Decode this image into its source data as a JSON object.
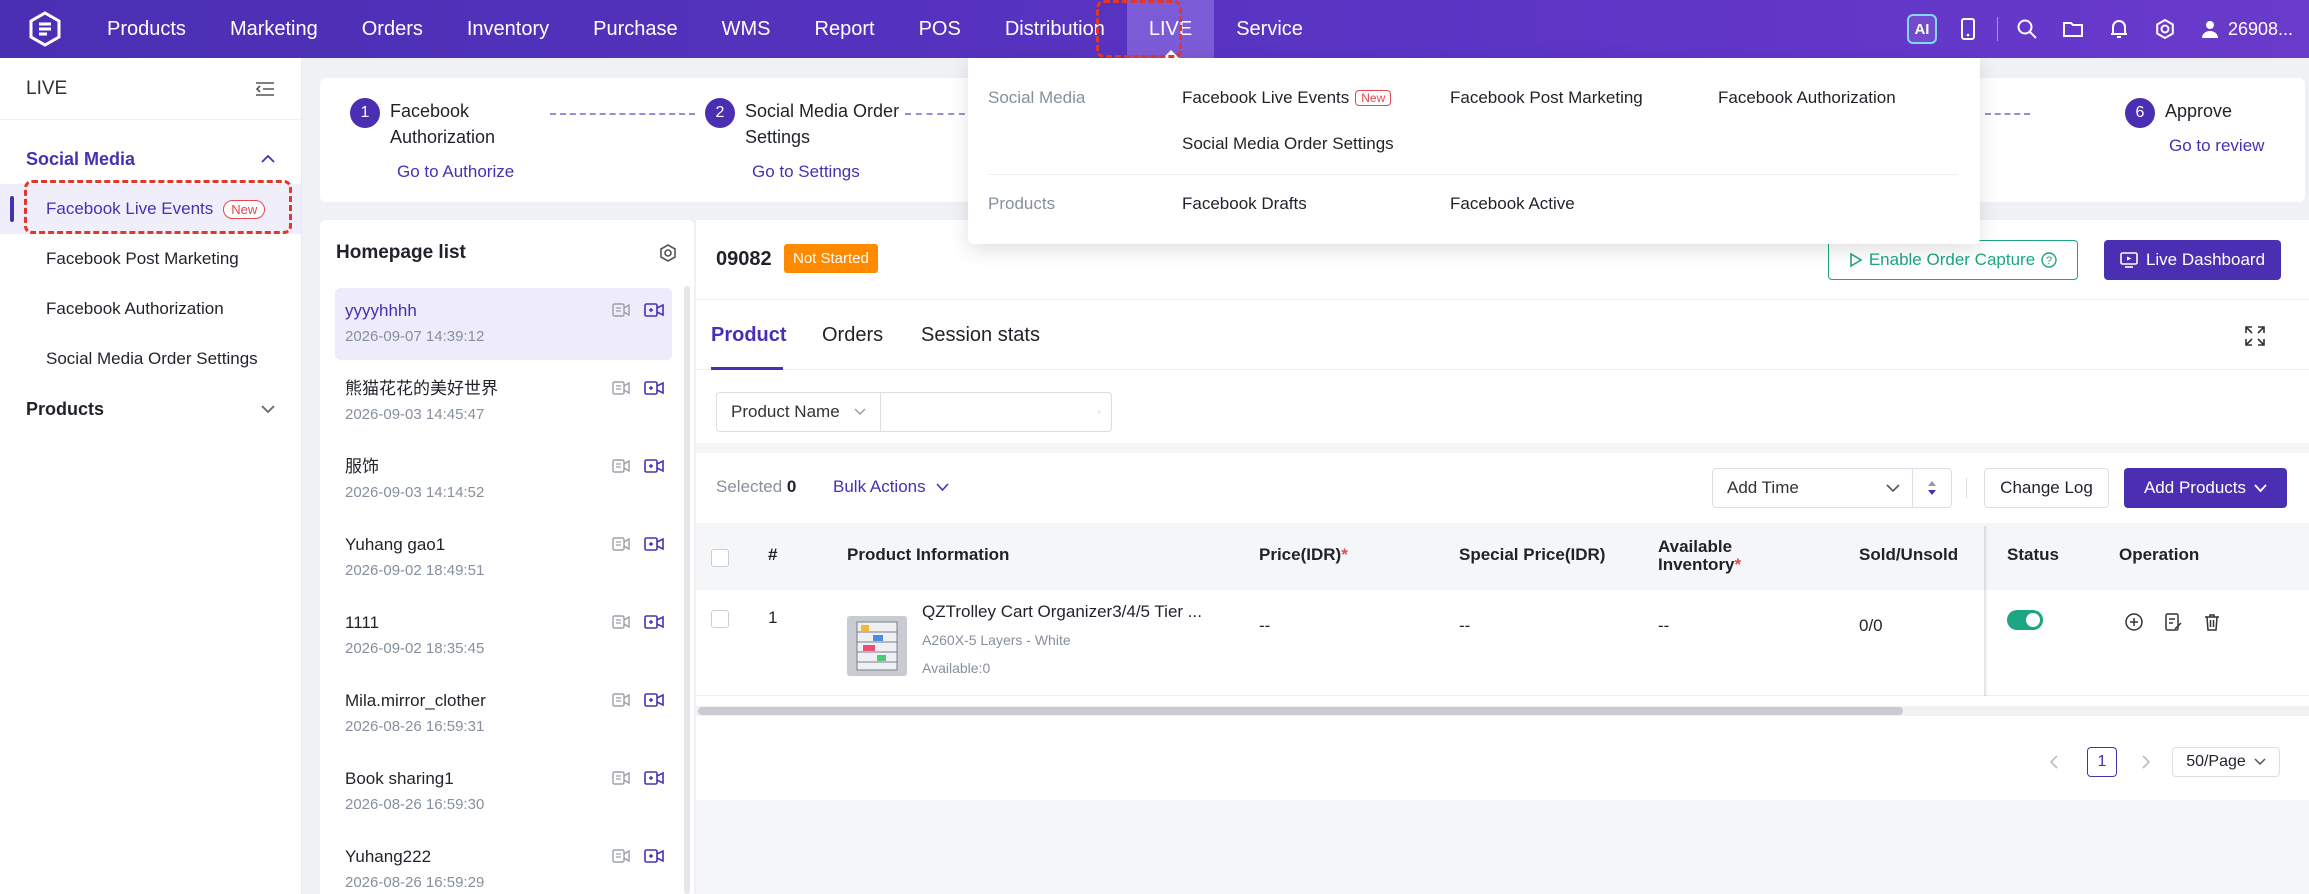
{
  "nav": {
    "items": [
      "Products",
      "Marketing",
      "Orders",
      "Inventory",
      "Purchase",
      "WMS",
      "Report",
      "POS",
      "Distribution",
      "LIVE",
      "Service"
    ],
    "active": "LIVE",
    "ai_label": "AI",
    "user": "26908..."
  },
  "sidebar": {
    "title": "LIVE",
    "groups": [
      {
        "label": "Social Media",
        "items": [
          "Facebook Live Events",
          "Facebook Post Marketing",
          "Facebook Authorization",
          "Social Media Order Settings"
        ]
      },
      {
        "label": "Products"
      }
    ],
    "new_badge": "New"
  },
  "steps": [
    {
      "num": "1",
      "title_line1": "Facebook",
      "title_line2": "Authorization",
      "link": "Go to Authorize"
    },
    {
      "num": "2",
      "title_line1": "Social Media Order",
      "title_line2": "Settings",
      "link": "Go to Settings"
    },
    {
      "num": "6",
      "title_line1": "Approve",
      "link": "Go to review"
    }
  ],
  "homepage_list": {
    "title": "Homepage list",
    "items": [
      {
        "name": "yyyyhhhh",
        "time": "2026-09-07 14:39:12"
      },
      {
        "name": "熊猫花花的美好世界",
        "time": "2026-09-03 14:45:47"
      },
      {
        "name": "服饰",
        "time": "2026-09-03 14:14:52"
      },
      {
        "name": "Yuhang gao1",
        "time": "2026-09-02 18:49:51"
      },
      {
        "name": "1111",
        "time": "2026-09-02 18:35:45"
      },
      {
        "name": "Mila.mirror_clother",
        "time": "2026-08-26 16:59:31"
      },
      {
        "name": "Book sharing1",
        "time": "2026-08-26 16:59:30"
      },
      {
        "name": "Yuhang222",
        "time": "2026-08-26 16:59:29"
      }
    ]
  },
  "session": {
    "id": "09082",
    "status": "Not Started",
    "enable_capture": "Enable Order Capture",
    "live_dashboard": "Live Dashboard"
  },
  "tabs": [
    "Product",
    "Orders",
    "Session stats"
  ],
  "filter": {
    "field": "Product Name",
    "search_placeholder": ""
  },
  "toolbar": {
    "selected_label": "Selected",
    "selected_count": "0",
    "bulk_actions": "Bulk Actions",
    "sort_label": "Add Time",
    "change_log": "Change Log",
    "add_products": "Add Products"
  },
  "table": {
    "headers": {
      "index": "#",
      "info": "Product Information",
      "price": "Price(IDR)",
      "special_price": "Special Price(IDR)",
      "inventory_line1": "Available",
      "inventory_line2": "Inventory",
      "sold": "Sold/Unsold",
      "status": "Status",
      "operation": "Operation"
    },
    "required_mark": "*",
    "rows": [
      {
        "index": "1",
        "name": "QZTrolley Cart Organizer3/4/5 Tier ...",
        "variant": "A260X-5 Layers - White",
        "available": "Available:0",
        "price": "--",
        "special_price": "--",
        "inventory": "--",
        "sold": "0/0",
        "status_on": true
      }
    ]
  },
  "pagination": {
    "current": "1",
    "page_size": "50/Page"
  },
  "live_menu": {
    "sections": [
      {
        "category": "Social Media",
        "links": [
          "Facebook Live Events",
          "Facebook Post Marketing",
          "Facebook Authorization",
          "Social Media Order Settings"
        ]
      },
      {
        "category": "Products",
        "links": [
          "Facebook Drafts",
          "Facebook Active"
        ]
      }
    ],
    "new_badge": "New"
  },
  "colors": {
    "brand": "#4a2fb3",
    "accent_green": "#1ea583",
    "warning": "#ff8a00",
    "highlight": "#e0382b"
  }
}
